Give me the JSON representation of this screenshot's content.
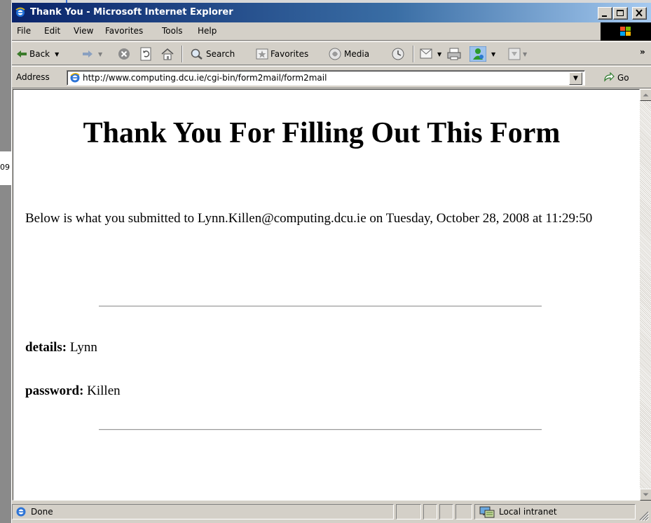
{
  "desktop": {
    "fragment_text": "09"
  },
  "window": {
    "title": "Thank You - Microsoft Internet Explorer"
  },
  "menu": {
    "items": [
      "File",
      "Edit",
      "View",
      "Favorites",
      "Tools",
      "Help"
    ]
  },
  "toolbar": {
    "back_label": "Back",
    "search_label": "Search",
    "favorites_label": "Favorites",
    "media_label": "Media",
    "overflow_label": "»"
  },
  "address": {
    "label": "Address",
    "url": "http://www.computing.dcu.ie/cgi-bin/form2mail/form2mail",
    "go_label": "Go"
  },
  "page": {
    "heading": "Thank You For Filling Out This Form",
    "intro": "Below is what you submitted to Lynn.Killen@computing.dcu.ie on Tuesday, October 28, 2008 at 11:29:50",
    "fields": [
      {
        "label": "details:",
        "value": "Lynn"
      },
      {
        "label": "password:",
        "value": "Killen"
      }
    ]
  },
  "status": {
    "text": "Done",
    "zone": "Local intranet"
  },
  "icons": {
    "ie": "ie-logo-icon",
    "back": "back-arrow-icon",
    "forward": "forward-arrow-icon",
    "stop": "stop-icon",
    "refresh": "refresh-icon",
    "home": "home-icon",
    "search": "search-icon",
    "favorites": "favorites-icon",
    "media": "media-icon",
    "history": "history-icon",
    "mail": "mail-icon",
    "print": "print-icon",
    "messenger": "messenger-icon",
    "go": "go-arrow-icon",
    "zone": "intranet-zone-icon"
  },
  "colors": {
    "titlebar_start": "#0a246a",
    "titlebar_end": "#a6caf0",
    "chrome": "#d4d0c8"
  }
}
